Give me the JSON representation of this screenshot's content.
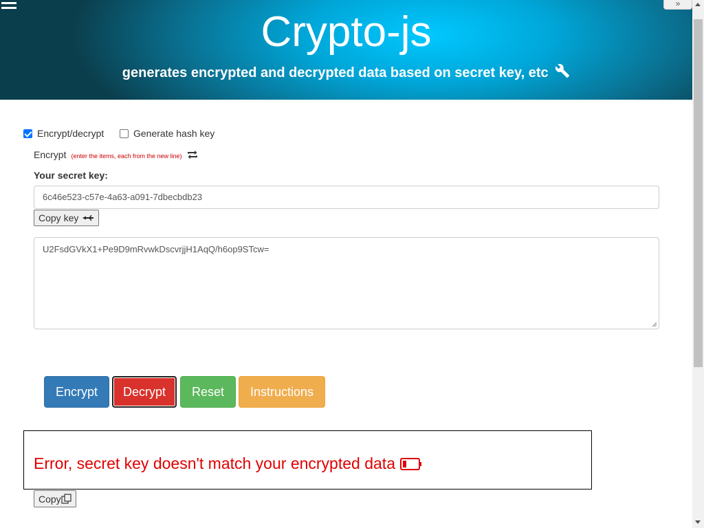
{
  "header": {
    "title": "Crypto-js",
    "subtitle": "generates encrypted and decrypted data based on secret key, etc",
    "background_color": "#00b4e6"
  },
  "options": {
    "encrypt_decrypt": {
      "label": "Encrypt/decrypt",
      "checked": true
    },
    "hash_key": {
      "label": "Generate hash key",
      "checked": false
    }
  },
  "mode": {
    "label": "Encrypt",
    "hint": "(enter the items, each from the new line)"
  },
  "secret_key": {
    "label": "Your secret key:",
    "value": "6c46e523-c57e-4a63-a091-7dbecbdb23"
  },
  "copy_key_label": "Copy key",
  "data_input": {
    "value": "U2FsdGVkX1+Pe9D9mRvwkDscvrjjH1AqQ/h6op9STcw="
  },
  "actions": {
    "encrypt": "Encrypt",
    "decrypt": "Decrypt",
    "reset": "Reset",
    "instructions": "Instructions"
  },
  "colors": {
    "encrypt": "#337ab7",
    "decrypt": "#d9312b",
    "reset": "#5cb85c",
    "instructions": "#f0ad4e",
    "error": "#e00000"
  },
  "result": {
    "message": "Error, secret key doesn't match your encrypted data",
    "icon": "battery-low-icon"
  },
  "copy_label": "Copy",
  "corner_button": "»"
}
